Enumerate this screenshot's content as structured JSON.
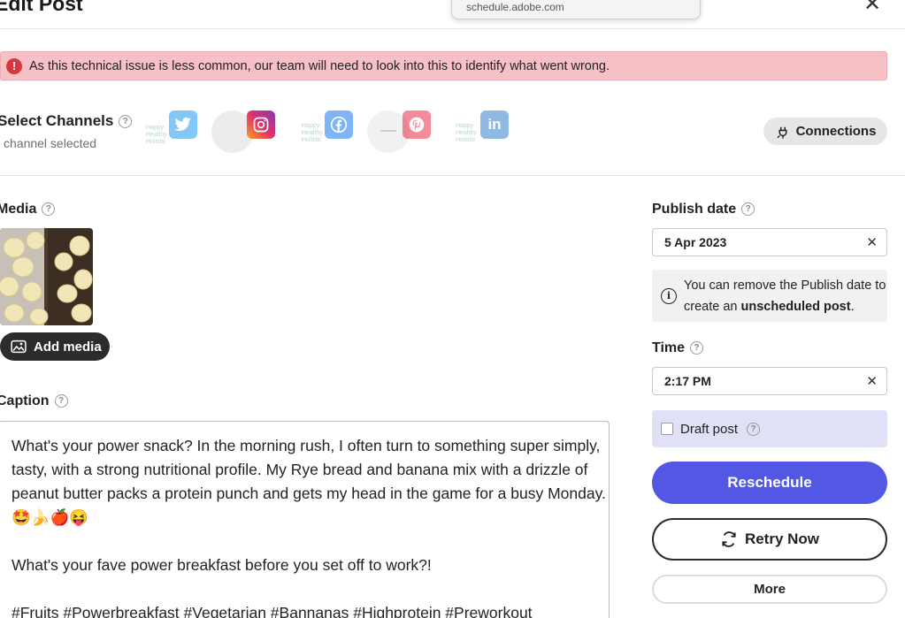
{
  "dialog": {
    "title": "Edit Post",
    "close_symbol": "✕"
  },
  "browser_popup": {
    "url": "schedule.adobe.com"
  },
  "alert": {
    "message": "As this technical issue is less common, our team will need to look into this to identify what went wrong."
  },
  "channels": {
    "title": "Select Channels",
    "subtitle": "channel selected",
    "logo_text": "Happy Healthy Holistic",
    "connections_label": "Connections"
  },
  "media": {
    "label": "Media",
    "add_label": "Add media"
  },
  "caption": {
    "label": "Caption",
    "paragraph1": "What's your power snack? In the morning rush, I often turn to something super simply, tasty, with a strong nutritional profile. My Rye bread and banana mix with a drizzle of peanut butter packs a protein punch and gets my head in the game for a busy Monday. 🤩🍌🍎😝",
    "paragraph2": "What's your fave power breakfast before you set off to work?!",
    "paragraph3": "#Fruits #Powerbreakfast #Vegetarian #Bannanas #Highprotein #Preworkout"
  },
  "publish": {
    "label": "Publish date",
    "value": "5 Apr 2023",
    "info_prefix": "You can remove the Publish date to create an ",
    "info_bold": "unscheduled post",
    "info_suffix": "."
  },
  "time": {
    "label": "Time",
    "value": "2:17 PM"
  },
  "draft": {
    "label": "Draft post"
  },
  "actions": {
    "reschedule": "Reschedule",
    "retry": "Retry Now",
    "more": "More"
  },
  "colors": {
    "primary": "#5258e4",
    "alert_bg": "#f5c1c6",
    "draft_bg": "#e0e0f6"
  }
}
